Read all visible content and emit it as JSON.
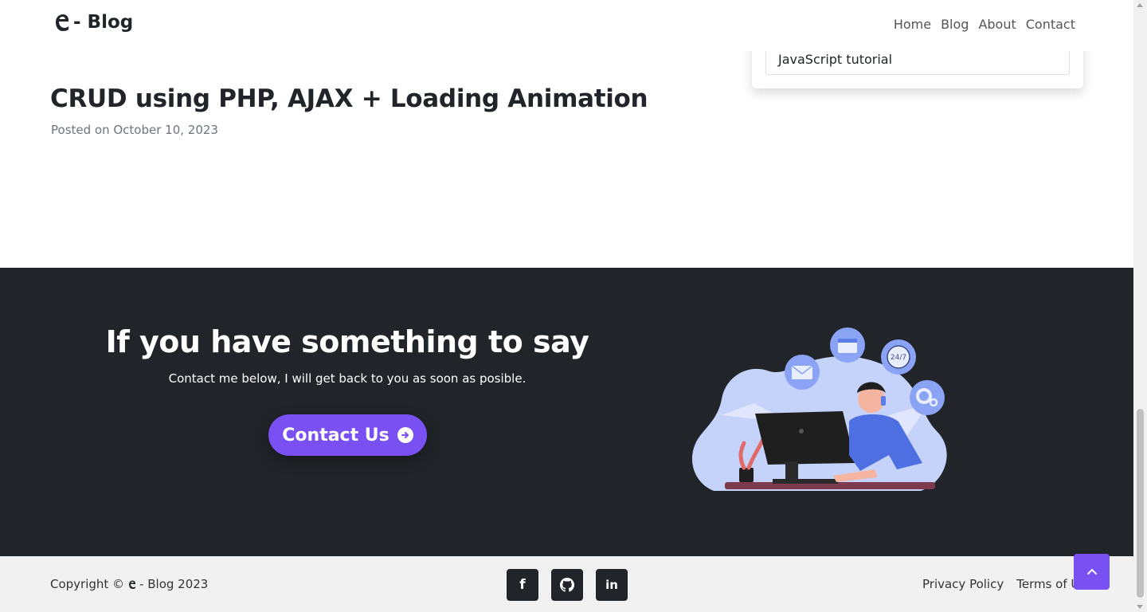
{
  "navbar": {
    "brand_text": "- Blog",
    "links": [
      "Home",
      "Blog",
      "About",
      "Contact"
    ]
  },
  "sidebar": {
    "tag_item": "JavaScript tutorial"
  },
  "post": {
    "title": "CRUD using PHP, AJAX + Loading Animation",
    "meta": "Posted on October 10, 2023"
  },
  "contact": {
    "title": "If you have something to say",
    "subtitle": "Contact me below, I will get back to you as soon as posible.",
    "button_label": "Contact Us",
    "illustration_clock_text": "24/7"
  },
  "footer": {
    "copyright_prefix": "Copyright ©",
    "copyright_suffix": "- Blog 2023",
    "socials": [
      {
        "icon": "facebook-icon",
        "glyph": "f"
      },
      {
        "icon": "github-icon",
        "glyph": ""
      },
      {
        "icon": "linkedin-icon",
        "glyph": "in"
      }
    ],
    "links": [
      "Privacy Policy",
      "Terms of Use"
    ]
  },
  "colors": {
    "accent": "#7950f2",
    "dark": "#212529",
    "footer_bg": "#f1f1f1"
  }
}
